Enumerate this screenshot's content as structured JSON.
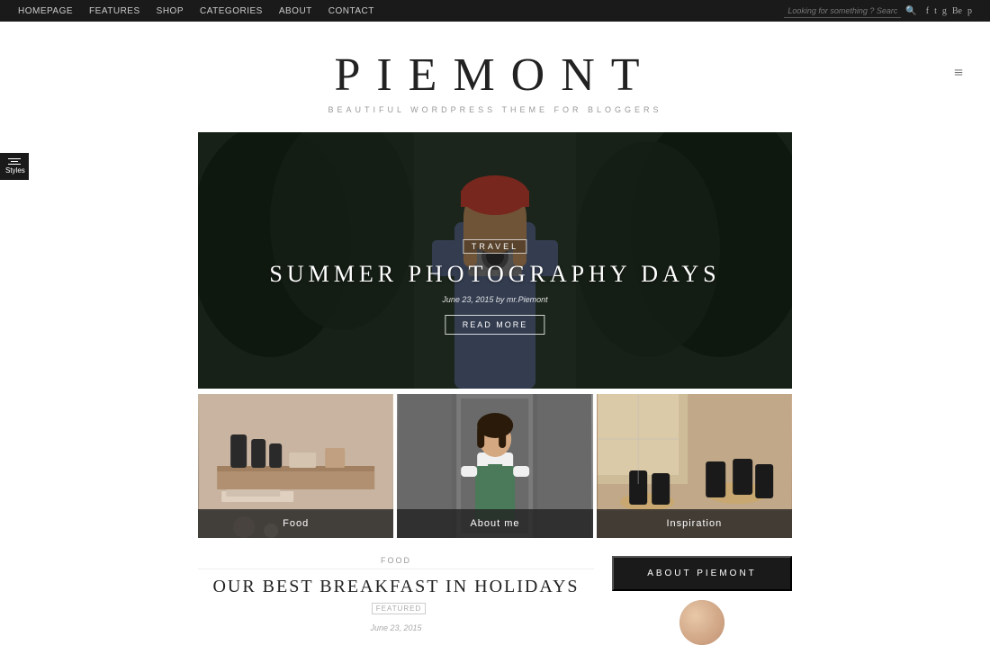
{
  "topnav": {
    "links": [
      {
        "label": "HOMEPAGE",
        "id": "homepage"
      },
      {
        "label": "FEATURES",
        "id": "features"
      },
      {
        "label": "SHOP",
        "id": "shop"
      },
      {
        "label": "CATEGORIES",
        "id": "categories"
      },
      {
        "label": "ABOUT",
        "id": "about"
      },
      {
        "label": "CONTACT",
        "id": "contact"
      }
    ],
    "search_placeholder": "Looking for something ? Search away?",
    "social": [
      "f",
      "t",
      "g+",
      "Be",
      "p"
    ]
  },
  "header": {
    "title": "PIEMONT",
    "subtitle": "BEAUTIFUL  WORDPRESS THEME FOR BLOGGERS",
    "hamburger": "≡"
  },
  "styles_btn": {
    "label": "Styles"
  },
  "hero": {
    "tag": "TRAVEL",
    "title": "SUMMER PHOTOGRAPHY DAYS",
    "meta": "June 23, 2015 by mr.Piemont",
    "read_more": "READ MORE"
  },
  "thumbnails": [
    {
      "label": "Food",
      "id": "food"
    },
    {
      "label": "About me",
      "id": "about-me"
    },
    {
      "label": "Inspiration",
      "id": "inspiration"
    }
  ],
  "post": {
    "category": "FOOD",
    "title": "OUR BEST BREAKFAST IN HOLIDAYS",
    "featured": "featured",
    "date": "June 23, 2015"
  },
  "sidebar": {
    "about_btn": "ABOUT PIEMONT"
  }
}
